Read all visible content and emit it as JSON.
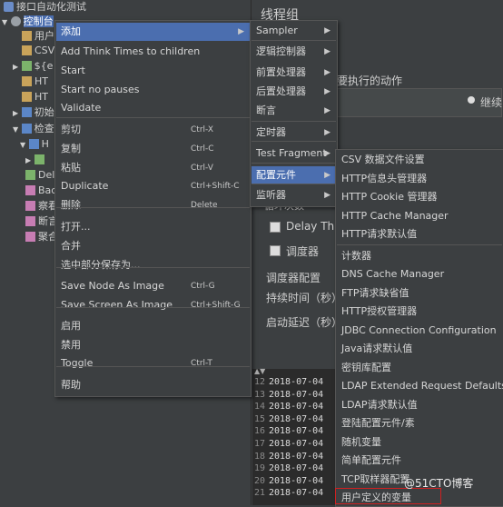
{
  "tree": {
    "items": [
      {
        "label": "接口自动化测试"
      },
      {
        "label": "控制台"
      },
      {
        "label": "用户"
      },
      {
        "label": "CSV"
      },
      {
        "label": "${e"
      },
      {
        "label": "HT"
      },
      {
        "label": "HT"
      },
      {
        "label": "初始"
      },
      {
        "label": "检查"
      },
      {
        "label": "H"
      },
      {
        "label": "Del"
      },
      {
        "label": "Bac"
      },
      {
        "label": "察看"
      },
      {
        "label": "断言"
      },
      {
        "label": "聚合"
      }
    ]
  },
  "panel": {
    "title": "线程组",
    "action_label": "要执行的动作",
    "continue_label": "继续",
    "loop_label": "循环次数",
    "delay_label": "Delay Thre",
    "scheduler_label": "调度器",
    "scheduler_config": "调度器配置",
    "duration_label": "持续时间（秒）",
    "startup_label": "启动延迟（秒）"
  },
  "log": {
    "lines": [
      {
        "n": "12",
        "text": "2018-07-04"
      },
      {
        "n": "13",
        "text": "2018-07-04"
      },
      {
        "n": "14",
        "text": "2018-07-04"
      },
      {
        "n": "15",
        "text": "2018-07-04"
      },
      {
        "n": "16",
        "text": "2018-07-04"
      },
      {
        "n": "17",
        "text": "2018-07-04"
      },
      {
        "n": "18",
        "text": "2018-07-04"
      },
      {
        "n": "19",
        "text": "2018-07-04"
      },
      {
        "n": "20",
        "text": "2018-07-04"
      },
      {
        "n": "21",
        "text": "2018-07-04"
      }
    ]
  },
  "context_menu": {
    "items": [
      {
        "label": "添加",
        "shortcut": "",
        "submenu": true
      },
      {
        "label": "Add Think Times to children",
        "shortcut": ""
      },
      {
        "label": "Start",
        "shortcut": ""
      },
      {
        "label": "Start no pauses",
        "shortcut": ""
      },
      {
        "label": "Validate",
        "shortcut": ""
      },
      {
        "label": "剪切",
        "shortcut": "Ctrl-X"
      },
      {
        "label": "复制",
        "shortcut": "Ctrl-C"
      },
      {
        "label": "粘贴",
        "shortcut": "Ctrl-V"
      },
      {
        "label": "Duplicate",
        "shortcut": "Ctrl+Shift-C"
      },
      {
        "label": "删除",
        "shortcut": "Delete"
      },
      {
        "label": "打开...",
        "shortcut": ""
      },
      {
        "label": "合并",
        "shortcut": ""
      },
      {
        "label": "选中部分保存为...",
        "shortcut": ""
      },
      {
        "label": "Save Node As Image",
        "shortcut": "Ctrl-G"
      },
      {
        "label": "Save Screen As Image",
        "shortcut": "Ctrl+Shift-G"
      },
      {
        "label": "启用",
        "shortcut": ""
      },
      {
        "label": "禁用",
        "shortcut": ""
      },
      {
        "label": "Toggle",
        "shortcut": "Ctrl-T"
      },
      {
        "label": "帮助",
        "shortcut": ""
      }
    ]
  },
  "add_submenu": {
    "items": [
      {
        "label": "Sampler"
      },
      {
        "label": "逻辑控制器"
      },
      {
        "label": "前置处理器"
      },
      {
        "label": "后置处理器"
      },
      {
        "label": "断言"
      },
      {
        "label": "定时器"
      },
      {
        "label": "Test Fragment"
      },
      {
        "label": "配置元件"
      },
      {
        "label": "监听器"
      }
    ]
  },
  "config_submenu": {
    "items": [
      {
        "label": "CSV 数据文件设置"
      },
      {
        "label": "HTTP信息头管理器"
      },
      {
        "label": "HTTP Cookie 管理器"
      },
      {
        "label": "HTTP Cache Manager"
      },
      {
        "label": "HTTP请求默认值"
      },
      {
        "label": "计数器"
      },
      {
        "label": "DNS Cache Manager"
      },
      {
        "label": "FTP请求缺省值"
      },
      {
        "label": "HTTP授权管理器"
      },
      {
        "label": "JDBC Connection Configuration"
      },
      {
        "label": "Java请求默认值"
      },
      {
        "label": "密钥库配置"
      },
      {
        "label": "LDAP Extended Request Defaults"
      },
      {
        "label": "LDAP请求默认值"
      },
      {
        "label": "登陆配置元件/素"
      },
      {
        "label": "随机变量"
      },
      {
        "label": "简单配置元件"
      },
      {
        "label": "TCP取样器配置"
      },
      {
        "label": "用户定义的变量"
      }
    ]
  },
  "watermark": "@51CTO博客",
  "colors": {
    "highlight": "#4b6eaf",
    "menu_bg": "#3c3f41",
    "annotation": "#d02020"
  }
}
